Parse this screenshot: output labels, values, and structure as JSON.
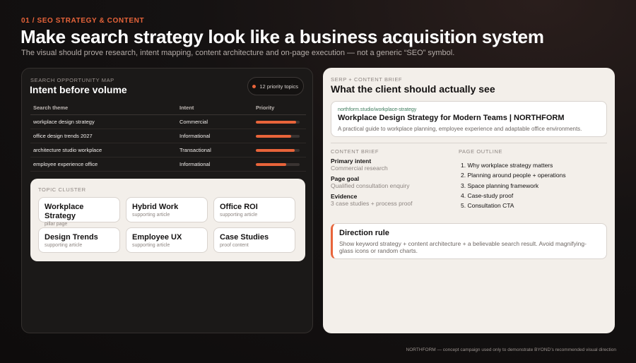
{
  "header": {
    "kicker": "01 / SEO STRATEGY & CONTENT",
    "title": "Make search strategy look like a business acquisition system",
    "subtitle": "The visual should prove research, intent mapping, content architecture and on-page execution — not a generic “SEO” symbol."
  },
  "opportunity_map": {
    "label": "SEARCH OPPORTUNITY MAP",
    "title": "Intent before volume",
    "badge": "12 priority topics",
    "columns": [
      "Search theme",
      "Intent",
      "Priority"
    ],
    "rows": [
      {
        "theme": "workplace design strategy",
        "intent": "Commercial",
        "priority": 0.92
      },
      {
        "theme": "office design trends 2027",
        "intent": "Informational",
        "priority": 0.8
      },
      {
        "theme": "architecture studio workplace",
        "intent": "Transactional",
        "priority": 0.88
      },
      {
        "theme": "employee experience office",
        "intent": "Informational",
        "priority": 0.7
      }
    ]
  },
  "topic_cluster": {
    "label": "TOPIC CLUSTER",
    "topics": [
      {
        "title": "Workplace Strategy",
        "type": "pillar page"
      },
      {
        "title": "Hybrid Work",
        "type": "supporting article"
      },
      {
        "title": "Office ROI",
        "type": "supporting article"
      },
      {
        "title": "Design Trends",
        "type": "supporting article"
      },
      {
        "title": "Employee UX",
        "type": "supporting article"
      },
      {
        "title": "Case Studies",
        "type": "proof content"
      }
    ]
  },
  "serp_brief": {
    "label": "SERP + CONTENT BRIEF",
    "title": "What the client should actually see",
    "result": {
      "url": "northform.studio/workplace-strategy",
      "title": "Workplace Design Strategy for Modern Teams | NORTHFORM",
      "description": "A practical guide to workplace planning, employee experience and adaptable office environments."
    }
  },
  "content_brief": {
    "label": "CONTENT BRIEF",
    "items": [
      {
        "key": "Primary intent",
        "value": "Commercial research"
      },
      {
        "key": "Page goal",
        "value": "Qualified consultation enquiry"
      },
      {
        "key": "Evidence",
        "value": "3 case studies + process proof"
      }
    ]
  },
  "page_outline": {
    "label": "PAGE OUTLINE",
    "items": [
      "1. Why workplace strategy matters",
      "2. Planning around people + operations",
      "3. Space planning framework",
      "4. Case-study proof",
      "5. Consultation CTA"
    ]
  },
  "direction_rule": {
    "title": "Direction rule",
    "text": "Show keyword strategy + content architecture + a believable search result. Avoid magnifying-glass icons or random charts."
  },
  "footnote": "NORTHFORM — concept campaign used only to demonstrate BYOND’s recommended visual direction",
  "colors": {
    "accent": "#e8643a",
    "panel_dark": "#1b1918",
    "panel_light": "#f3efea",
    "url_green": "#3b7a5a"
  }
}
